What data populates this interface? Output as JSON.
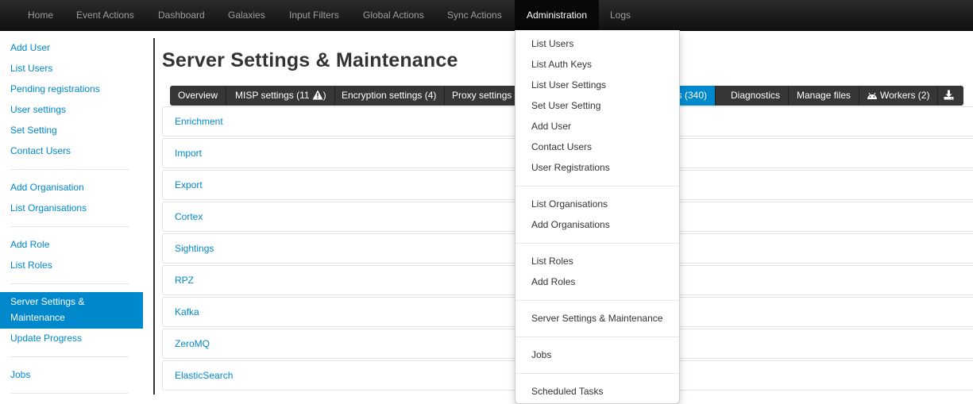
{
  "navbar": {
    "items": [
      {
        "label": "Home"
      },
      {
        "label": "Event Actions"
      },
      {
        "label": "Dashboard"
      },
      {
        "label": "Galaxies"
      },
      {
        "label": "Input Filters"
      },
      {
        "label": "Global Actions"
      },
      {
        "label": "Sync Actions"
      },
      {
        "label": "Administration"
      },
      {
        "label": "Logs"
      }
    ],
    "active": "Administration"
  },
  "sidebar": {
    "items": [
      {
        "label": "Add User"
      },
      {
        "label": "List Users"
      },
      {
        "label": "Pending registrations"
      },
      {
        "label": "User settings"
      },
      {
        "label": "Set Setting"
      },
      {
        "label": "Contact Users"
      },
      {
        "label": "Add Organisation"
      },
      {
        "label": "List Organisations"
      },
      {
        "label": "Add Role"
      },
      {
        "label": "List Roles"
      },
      {
        "label": "Server Settings &"
      },
      {
        "label": "Maintenance"
      },
      {
        "label": "Update Progress"
      },
      {
        "label": "Jobs"
      }
    ]
  },
  "main": {
    "title": "Server Settings & Maintenance",
    "tabs": [
      {
        "label": "Overview"
      },
      {
        "label": "MISP settings (11"
      },
      {
        "label": ")"
      },
      {
        "label": "Encryption settings (4)"
      },
      {
        "label": "Proxy settings"
      },
      {
        "label": "gs (340)"
      },
      {
        "label": "Diagnostics"
      },
      {
        "label": "Manage files"
      },
      {
        "label": "Workers (2)"
      }
    ],
    "categories": [
      {
        "label": "Enrichment"
      },
      {
        "label": "Import"
      },
      {
        "label": "Export"
      },
      {
        "label": "Cortex"
      },
      {
        "label": "Sightings"
      },
      {
        "label": "RPZ"
      },
      {
        "label": "Kafka"
      },
      {
        "label": "ZeroMQ"
      },
      {
        "label": "ElasticSearch"
      }
    ]
  },
  "dropdown": {
    "items": [
      {
        "label": "List Users"
      },
      {
        "label": "List Auth Keys"
      },
      {
        "label": "List User Settings"
      },
      {
        "label": "Set User Setting"
      },
      {
        "label": "Add User"
      },
      {
        "label": "Contact Users"
      },
      {
        "label": "User Registrations"
      },
      {
        "label": "List Organisations"
      },
      {
        "label": "Add Organisations"
      },
      {
        "label": "List Roles"
      },
      {
        "label": "Add Roles"
      },
      {
        "label": "Server Settings & Maintenance"
      },
      {
        "label": "Jobs"
      },
      {
        "label": "Scheduled Tasks"
      }
    ]
  },
  "colors": {
    "link": "#0088cc",
    "navbar": "#1b1b1b",
    "active_tab": "#0088cc",
    "tab_bar": "#363636"
  }
}
